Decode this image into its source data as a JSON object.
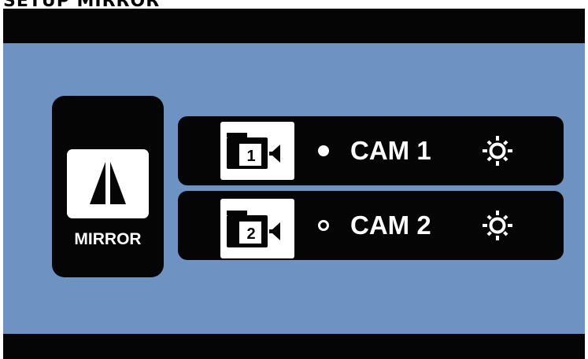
{
  "page": {
    "title": "SETUP MIRROR"
  },
  "mirror": {
    "label": "MIRROR",
    "icon": "mirror-flip-icon"
  },
  "cameras": [
    {
      "number": "1",
      "label": "CAM 1",
      "status": "selected",
      "camera_icon": "video-camera-icon",
      "settings_icon": "brightness-sun-icon"
    },
    {
      "number": "2",
      "label": "CAM 2",
      "status": "unselected",
      "camera_icon": "video-camera-icon",
      "settings_icon": "brightness-sun-icon"
    }
  ],
  "colors": {
    "screen_background": "#6e93c3",
    "panel": "#050505",
    "foreground": "#ffffff"
  }
}
